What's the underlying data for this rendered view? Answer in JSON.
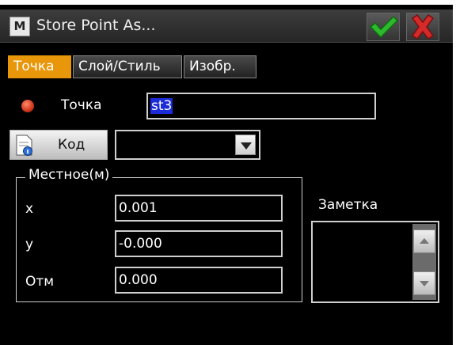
{
  "window": {
    "title": "Store Point As...",
    "app_icon_text": "M",
    "ok_icon": "checkmark-icon",
    "cancel_icon": "close-icon"
  },
  "tabs": [
    {
      "label": "Точка",
      "active": true
    },
    {
      "label": "Слой/Стиль",
      "active": false
    },
    {
      "label": "Изобр.",
      "active": false
    }
  ],
  "point": {
    "label": "Точка",
    "value": "st3"
  },
  "code": {
    "button_label": "Код",
    "value": ""
  },
  "local": {
    "title": "Местное(м)",
    "fields": [
      {
        "label": "x",
        "value": "0.001"
      },
      {
        "label": "y",
        "value": "-0.000"
      },
      {
        "label": "Отм",
        "value": "0.000"
      }
    ]
  },
  "note": {
    "label": "Заметка",
    "value": ""
  },
  "colors": {
    "active_tab": "#e8960a",
    "ok_green": "#2db82d",
    "cancel_red": "#d42a2a",
    "selection": "#1c2bd8"
  }
}
